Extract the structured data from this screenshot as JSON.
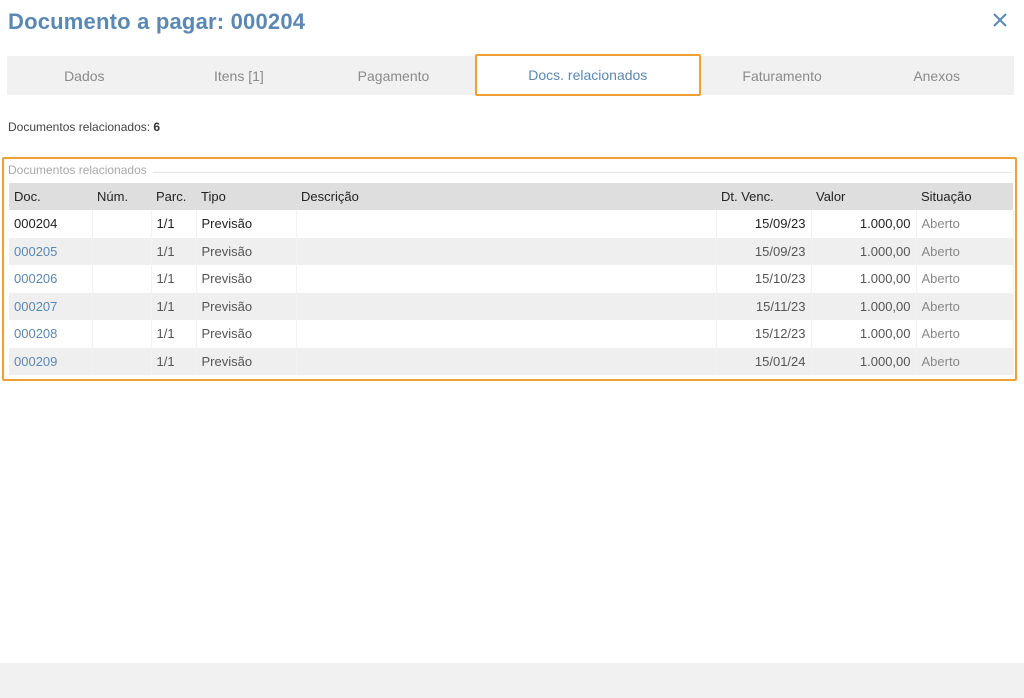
{
  "header": {
    "title": "Documento a pagar: 000204"
  },
  "tabs": [
    {
      "label": "Dados",
      "active": false
    },
    {
      "label": "Itens [1]",
      "active": false
    },
    {
      "label": "Pagamento",
      "active": false
    },
    {
      "label": "Docs. relacionados",
      "active": true
    },
    {
      "label": "Faturamento",
      "active": false
    },
    {
      "label": "Anexos",
      "active": false
    }
  ],
  "summary": {
    "label": "Documentos relacionados:",
    "count": "6"
  },
  "related": {
    "legend": "Documentos relacionados",
    "columns": [
      "Doc.",
      "Núm.",
      "Parc.",
      "Tipo",
      "Descrição",
      "Dt. Venc.",
      "Valor",
      "Situação"
    ],
    "rows": [
      {
        "doc": "000204",
        "num": "",
        "parc": "1/1",
        "tipo": "Previsão",
        "descricao": "",
        "venc": "15/09/23",
        "valor": "1.000,00",
        "situacao": "Aberto",
        "current": true
      },
      {
        "doc": "000205",
        "num": "",
        "parc": "1/1",
        "tipo": "Previsão",
        "descricao": "",
        "venc": "15/09/23",
        "valor": "1.000,00",
        "situacao": "Aberto",
        "current": false
      },
      {
        "doc": "000206",
        "num": "",
        "parc": "1/1",
        "tipo": "Previsão",
        "descricao": "",
        "venc": "15/10/23",
        "valor": "1.000,00",
        "situacao": "Aberto",
        "current": false
      },
      {
        "doc": "000207",
        "num": "",
        "parc": "1/1",
        "tipo": "Previsão",
        "descricao": "",
        "venc": "15/11/23",
        "valor": "1.000,00",
        "situacao": "Aberto",
        "current": false
      },
      {
        "doc": "000208",
        "num": "",
        "parc": "1/1",
        "tipo": "Previsão",
        "descricao": "",
        "venc": "15/12/23",
        "valor": "1.000,00",
        "situacao": "Aberto",
        "current": false
      },
      {
        "doc": "000209",
        "num": "",
        "parc": "1/1",
        "tipo": "Previsão",
        "descricao": "",
        "venc": "15/01/24",
        "valor": "1.000,00",
        "situacao": "Aberto",
        "current": false
      }
    ]
  },
  "icons": {
    "close": "close-icon"
  },
  "colors": {
    "accent": "#5b88b3",
    "highlight": "#f0a030"
  }
}
